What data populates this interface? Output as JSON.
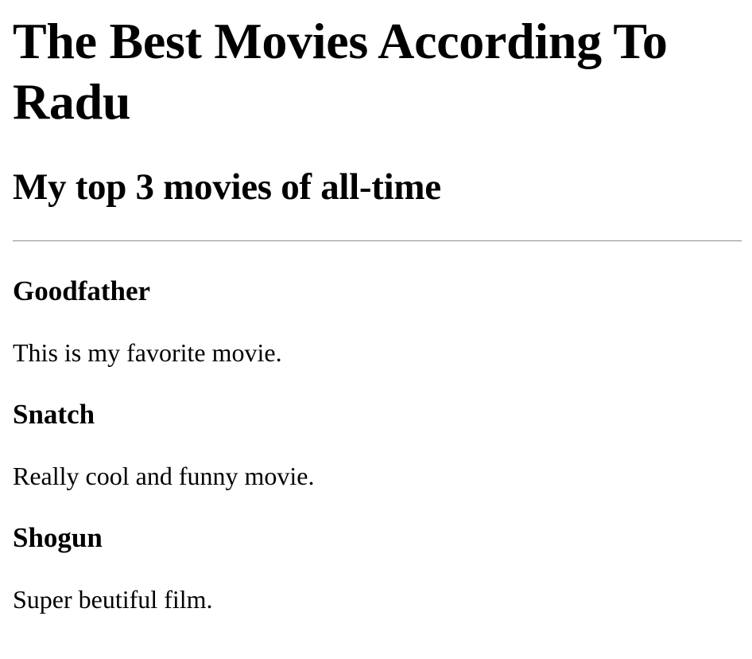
{
  "header": {
    "title": "The Best Movies According To Radu",
    "subtitle": "My top 3 movies of all-time"
  },
  "movies": [
    {
      "title": "Goodfather",
      "description": "This is my favorite movie."
    },
    {
      "title": "Snatch",
      "description": "Really cool and funny movie."
    },
    {
      "title": "Shogun",
      "description": "Super beutiful film."
    }
  ]
}
